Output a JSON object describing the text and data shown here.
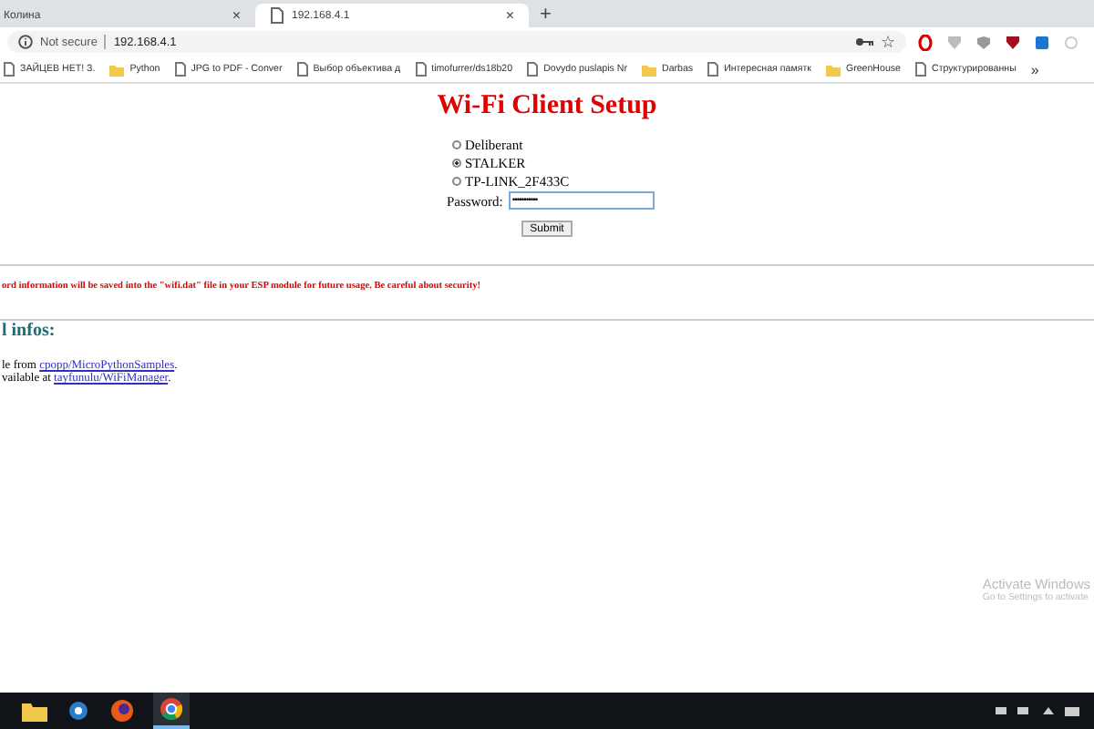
{
  "browser": {
    "tabs": [
      {
        "title": "Колина",
        "close": "×",
        "selected": false
      },
      {
        "title": "192.168.4.1",
        "close": "×",
        "selected": true
      }
    ],
    "new_tab": "+",
    "star": "☆",
    "address": {
      "security": "Not secure",
      "url": "192.168.4.1"
    },
    "bookmarks": [
      {
        "label": "ЗАЙЦЕВ НЕТ! З.",
        "kind": "page"
      },
      {
        "label": "Python",
        "kind": "folder"
      },
      {
        "label": "JPG to PDF - Conver",
        "kind": "page"
      },
      {
        "label": "Выбор объектива д",
        "kind": "page"
      },
      {
        "label": "timofurrer/ds18b20",
        "kind": "page"
      },
      {
        "label": "Dovydo puslapis Nr",
        "kind": "page"
      },
      {
        "label": "Darbas",
        "kind": "folder"
      },
      {
        "label": "Интересная памятк",
        "kind": "page"
      },
      {
        "label": "GreenHouse",
        "kind": "folder"
      },
      {
        "label": "Структурированны",
        "kind": "page"
      }
    ],
    "more_bookmarks": "»"
  },
  "page": {
    "title": "Wi-Fi Client Setup",
    "networks": [
      {
        "ssid": "Deliberant",
        "selected": false
      },
      {
        "ssid": "STALKER",
        "selected": true
      },
      {
        "ssid": "TP-LINK_2F433C",
        "selected": false
      }
    ],
    "password_label": "Password:",
    "password_value": "•••••••••••",
    "submit": "Submit",
    "warning": "ord information will be saved into the \"wifi.dat\" file in your ESP module for future usage. Be careful about security!",
    "infos_heading": "l infos:",
    "info_lines": [
      {
        "before": "le from ",
        "link": "cpopp/MicroPythonSamples",
        "after": "."
      },
      {
        "before": "vailable at ",
        "link": "tayfunulu/WiFiManager",
        "after": "."
      }
    ]
  },
  "activation": {
    "title": "Activate Windows",
    "subtitle": "Go to Settings to activate"
  }
}
